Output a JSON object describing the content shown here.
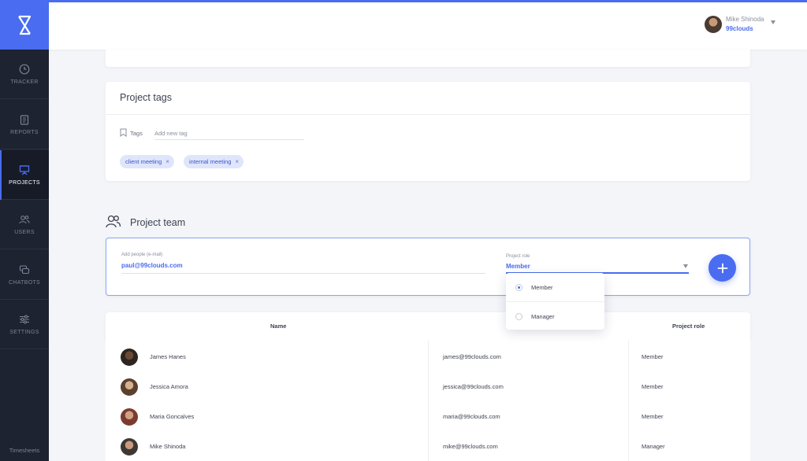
{
  "app": {
    "brand_color": "#4a6cf0",
    "sidebar_bg": "#1d2330"
  },
  "sidebar": {
    "items": [
      {
        "label": "TRACKER",
        "icon": "clock-icon"
      },
      {
        "label": "REPORTS",
        "icon": "clipboard-icon"
      },
      {
        "label": "PROJECTS",
        "icon": "presentation-board-icon",
        "active": true
      },
      {
        "label": "USERS",
        "icon": "users-icon"
      },
      {
        "label": "CHATBOTS",
        "icon": "chat-bubbles-icon"
      },
      {
        "label": "SETTINGS",
        "icon": "sliders-icon"
      }
    ],
    "footer": "Timesheets"
  },
  "header": {
    "user_name": "Mike Shinoda",
    "user_org": "99clouds"
  },
  "project_tags": {
    "title": "Project tags",
    "tags_label": "Tags",
    "input_placeholder": "Add new tag",
    "chips": [
      "client meeting",
      "internal meeting"
    ]
  },
  "project_team": {
    "title": "Project team",
    "add_people_label": "Add people (e-mail)",
    "add_people_value": "paul@99clouds.com",
    "role_label": "Project role",
    "role_value": "Member",
    "role_options": [
      {
        "label": "Member",
        "selected": true
      },
      {
        "label": "Manager",
        "selected": false
      }
    ]
  },
  "table": {
    "columns": [
      "Name",
      "",
      "Project role"
    ],
    "rows": [
      {
        "name": "James Hanes",
        "email": "james@99clouds.com",
        "role": "Member"
      },
      {
        "name": "Jessica Amora",
        "email": "jessica@99clouds.com",
        "role": "Member"
      },
      {
        "name": "Maria Goncalves",
        "email": "maria@99clouds.com",
        "role": "Member"
      },
      {
        "name": "Mike Shinoda",
        "email": "mike@99clouds.com",
        "role": "Manager"
      }
    ]
  }
}
